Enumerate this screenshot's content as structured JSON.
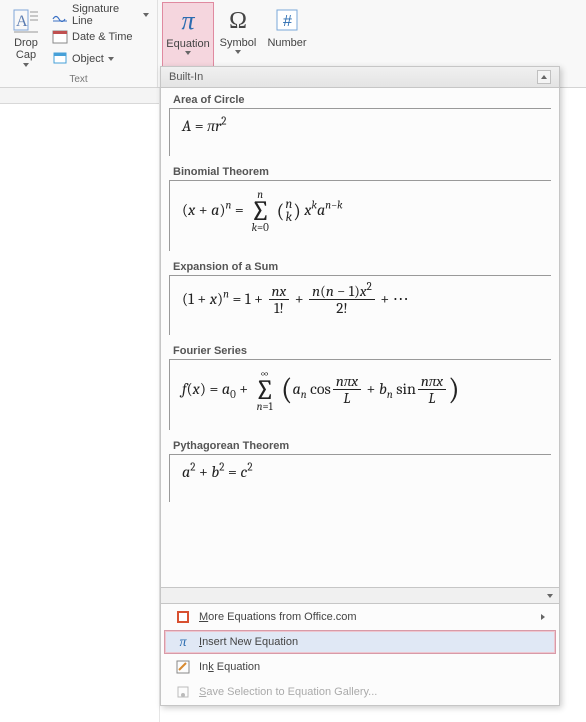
{
  "ribbon": {
    "dropcap_label": "Drop Cap",
    "sigline_label": "Signature Line",
    "datetime_label": "Date & Time",
    "object_label": "Object",
    "text_group_label": "Text",
    "equation_label": "Equation",
    "symbol_label": "Symbol",
    "number_label": "Number"
  },
  "dropdown": {
    "header": "Built-In",
    "equations": [
      {
        "title": "Area of Circle"
      },
      {
        "title": "Binomial Theorem"
      },
      {
        "title": "Expansion of a Sum"
      },
      {
        "title": "Fourier Series"
      },
      {
        "title": "Pythagorean Theorem"
      }
    ],
    "footer": {
      "more": "More Equations from Office.com",
      "insert": "Insert New Equation",
      "ink": "Ink Equation",
      "save": "Save Selection to Equation Gallery..."
    }
  },
  "equations_content": {
    "area_of_circle": "A = πr²",
    "binomial_theorem": "(x + a)^n = Σ_{k=0}^{n} C(n,k) x^k a^{n-k}",
    "expansion_of_sum": "(1 + x)^n = 1 + nx/1! + n(n-1)x²/2! + ⋯",
    "fourier_series": "f(x) = a₀ + Σ_{n=1}^{∞} (aₙ cos(nπx/L) + bₙ sin(nπx/L))",
    "pythagorean_theorem": "a² + b² = c²"
  }
}
